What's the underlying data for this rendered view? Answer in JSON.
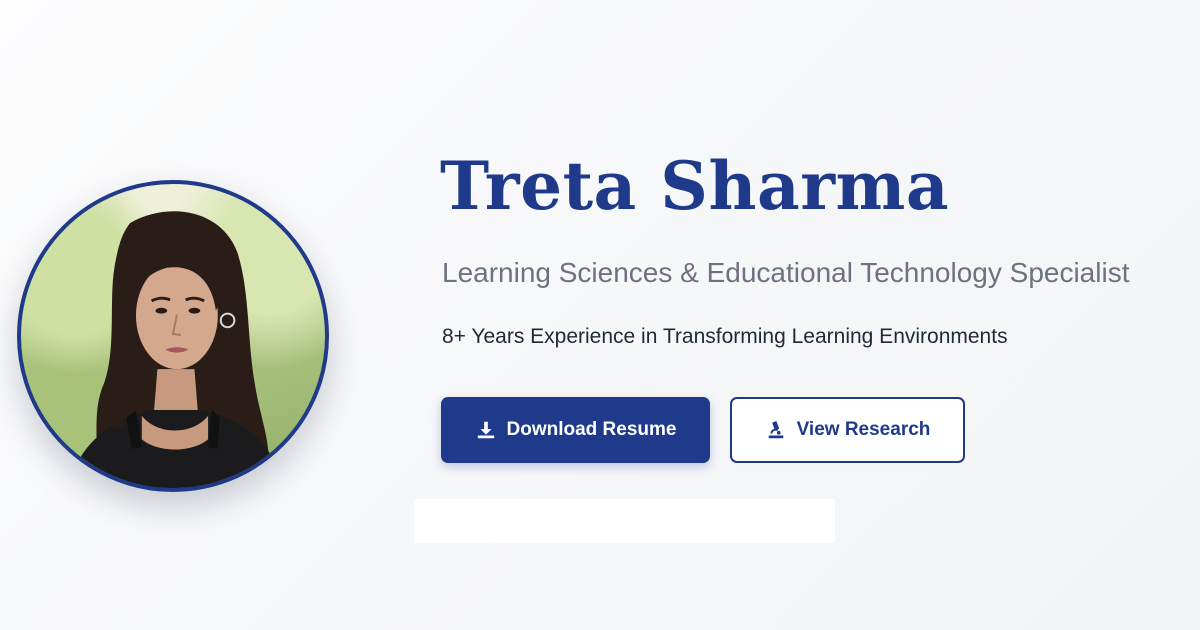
{
  "profile": {
    "name": "Treta Sharma",
    "title": "Learning Sciences & Educational Technology Specialist",
    "experience": "8+ Years Experience in Transforming Learning Environments"
  },
  "buttons": {
    "download": {
      "label": "Download Resume",
      "icon": "download-icon"
    },
    "research": {
      "label": "View Research",
      "icon": "microscope-icon"
    }
  },
  "colors": {
    "brand": "#1f3a8a",
    "subtitle": "#6b7280",
    "body_text": "#1f2937",
    "background": "#f6f7f9"
  }
}
